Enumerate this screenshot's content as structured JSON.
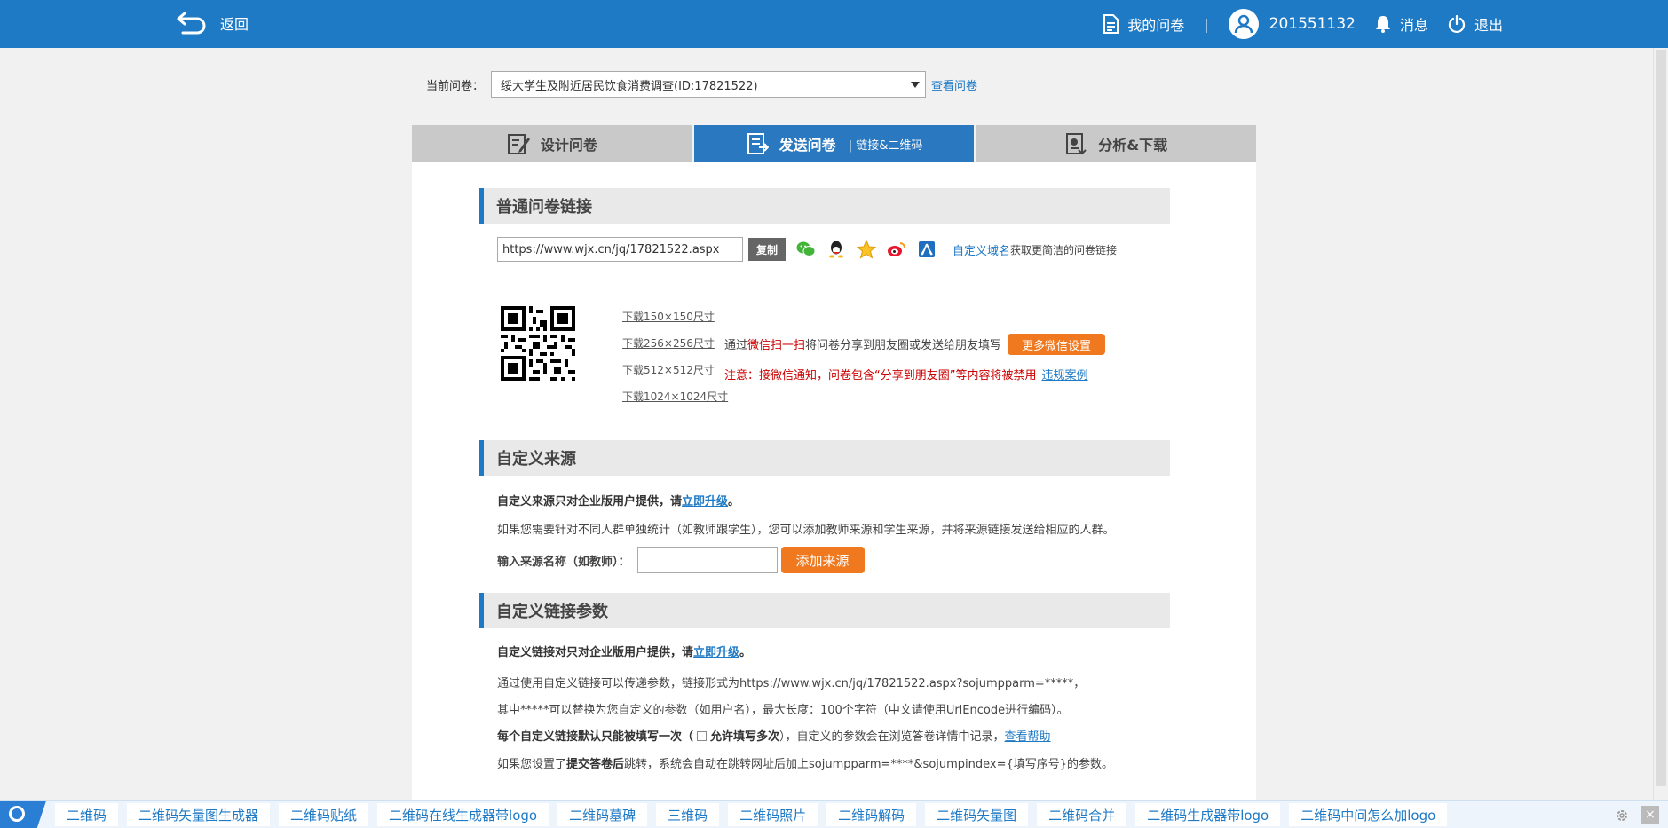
{
  "topbar": {
    "back_label": "返回",
    "my_surveys_label": "我的问卷",
    "separator": "|",
    "user_id": "201551132",
    "messages_label": "消息",
    "logout_label": "退出"
  },
  "selector": {
    "label": "当前问卷：",
    "value": "绥大学生及附近居民饮食消费调查(ID:17821522)",
    "view_link": "查看问卷"
  },
  "tabs": [
    {
      "label": "设计问卷",
      "sub": ""
    },
    {
      "label": "发送问卷",
      "sub": "| 链接&二维码"
    },
    {
      "label": "分析&下载",
      "sub": ""
    }
  ],
  "link_section": {
    "title": "普通问卷链接",
    "url": "https://www.wjx.cn/jq/17821522.aspx",
    "copy_label": "复制",
    "domain_link": "自定义域名",
    "domain_tip": "获取更简洁的问卷链接",
    "downloads": [
      "下载150×150尺寸",
      "下载256×256尺寸",
      "下载512×512尺寸",
      "下载1024×1024尺寸"
    ],
    "wx_prefix": "通过",
    "wx_red": "微信扫一扫",
    "wx_suffix": "将问卷分享到朋友圈或发送给朋友填写",
    "more_wx_label": "更多微信设置",
    "warning": "注意：接微信通知，问卷包含“分享到朋友圈”等内容将被禁用",
    "violation_link": "违规案例"
  },
  "source_section": {
    "title": "自定义来源",
    "enterprise_note": "自定义来源只对企业版用户提供，请",
    "upgrade_link": "立即升级",
    "period": "。",
    "description": "如果您需要针对不同人群单独统计（如教师跟学生），您可以添加教师来源和学生来源，并将来源链接发送给相应的人群。",
    "input_label": "输入来源名称（如教师）：",
    "add_button": "添加来源"
  },
  "param_section": {
    "title": "自定义链接参数",
    "enterprise_note": "自定义链接对只对企业版用户提供，请",
    "upgrade_link": "立即升级",
    "period": "。",
    "line1": "通过使用自定义链接可以传递参数，链接形式为https://www.wjx.cn/jq/17821522.aspx?sojumpparm=*****，",
    "line2": "其中*****可以替换为您自定义的参数（如用户名），最大长度：100个字符（中文请使用UrlEncode进行编码）。",
    "line3_bold": "每个自定义链接默认只能被填写一次（",
    "line3_cb": "允许填写多次",
    "line3_rest": "），自定义的参数会在浏览答卷详情中记录，",
    "help_link": "查看帮助",
    "line4_prefix": "如果您设置了",
    "line4_link": "提交答卷后",
    "line4_suffix": "跳转，系统会自动在跳转网址后加上sojumpparm=****&sojumpindex={填写序号}的参数。"
  },
  "bottombar": {
    "items": [
      "二维码",
      "二维码矢量图生成器",
      "二维码贴纸",
      "二维码在线生成器带logo",
      "二维码墓碑",
      "三维码",
      "二维码照片",
      "二维码解码",
      "二维码矢量图",
      "二维码合并",
      "二维码生成器带logo",
      "二维码中间怎么加logo"
    ],
    "close_label": "×"
  },
  "colors": {
    "primary": "#1f7ac6",
    "active_tab": "#2a78c0",
    "orange": "#f0781e",
    "warning": "#cc0000"
  }
}
